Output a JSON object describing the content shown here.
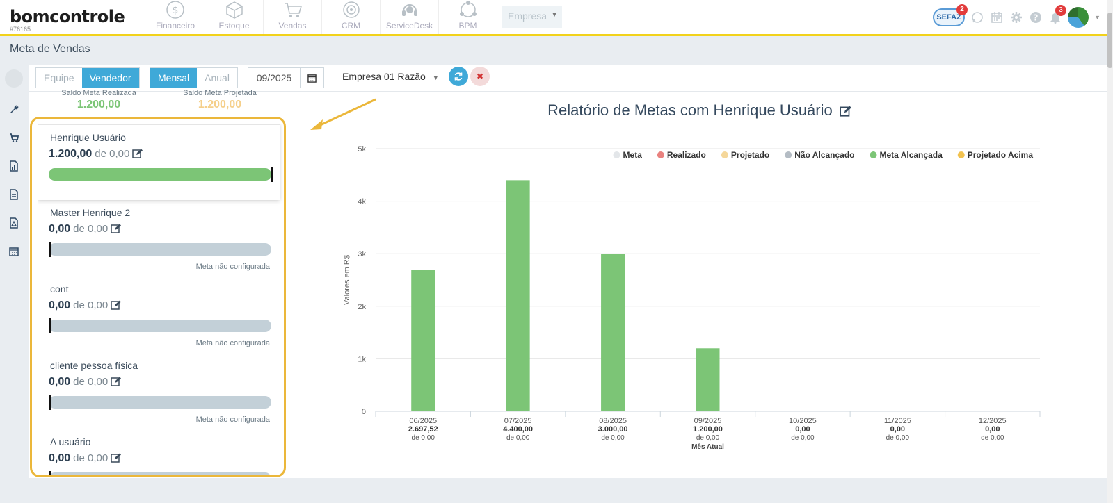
{
  "app": {
    "logo": "bomcontrole",
    "account_id": "#76165"
  },
  "modules": [
    "Financeiro",
    "Estoque",
    "Vendas",
    "CRM",
    "ServiceDesk",
    "BPM"
  ],
  "empresa_select": "Empresa",
  "header_right": {
    "sefaz_label": "SEFAZ",
    "sefaz_badge": "2",
    "notif_badge": "3"
  },
  "page": {
    "title": "Meta de Vendas"
  },
  "toolbar": {
    "scope_options": [
      "Equipe",
      "Vendedor"
    ],
    "scope_active": "Vendedor",
    "period_options": [
      "Mensal",
      "Anual"
    ],
    "period_active": "Mensal",
    "date_value": "09/2025",
    "empresa_dropdown": "Empresa 01 Razão"
  },
  "saldo": {
    "realizada_label": "Saldo Meta Realizada",
    "realizada_value": "1.200,00",
    "projetada_label": "Saldo Meta Projetada",
    "projetada_value": "1.200,00"
  },
  "users": [
    {
      "name": "Henrique Usuário",
      "realizado": "1.200,00",
      "de_label": "de 0,00",
      "progress": 1.0,
      "note": ""
    },
    {
      "name": "Master Henrique 2",
      "realizado": "0,00",
      "de_label": "de 0,00",
      "progress": 0.0,
      "note": "Meta não configurada"
    },
    {
      "name": "cont",
      "realizado": "0,00",
      "de_label": "de 0,00",
      "progress": 0.0,
      "note": "Meta não configurada"
    },
    {
      "name": "cliente pessoa física",
      "realizado": "0,00",
      "de_label": "de 0,00",
      "progress": 0.0,
      "note": "Meta não configurada"
    },
    {
      "name": "A usuário",
      "realizado": "0,00",
      "de_label": "de 0,00",
      "progress": 0.0,
      "note": ""
    }
  ],
  "colors": {
    "accent": "#3fa9d8",
    "highlight": "#ebb73a",
    "realizada_green": "#7cc576",
    "projetada_yellow": "#f5cf8a"
  },
  "chart_data": {
    "type": "bar",
    "title": "Relatório de Metas com Henrique Usuário",
    "ylabel": "Valores em R$",
    "ylim": [
      0,
      5000
    ],
    "yticks": [
      "0",
      "1k",
      "2k",
      "3k",
      "4k",
      "5k"
    ],
    "grid": true,
    "legend_position": "top-right",
    "legend": [
      {
        "name": "Meta",
        "color": "#e3e6e9"
      },
      {
        "name": "Realizado",
        "color": "#e9827f"
      },
      {
        "name": "Projetado",
        "color": "#f5d79a"
      },
      {
        "name": "Não Alcançado",
        "color": "#b4bcc4"
      },
      {
        "name": "Meta Alcançada",
        "color": "#7cc576"
      },
      {
        "name": "Projetado Acima",
        "color": "#f2c24f"
      }
    ],
    "categories": [
      "06/2025",
      "07/2025",
      "08/2025",
      "09/2025",
      "10/2025",
      "11/2025",
      "12/2025"
    ],
    "category_values_label": [
      "2.697,52",
      "4.400,00",
      "3.000,00",
      "1.200,00",
      "0,00",
      "0,00",
      "0,00"
    ],
    "category_meta_label": [
      "de 0,00",
      "de 0,00",
      "de 0,00",
      "de 0,00",
      "de 0,00",
      "de 0,00",
      "de 0,00"
    ],
    "current_month_label": "Mês Atual",
    "current_month_index": 3,
    "series": [
      {
        "name": "Meta Alcançada",
        "values": [
          2697.52,
          4400,
          3000,
          1200,
          0,
          0,
          0
        ]
      }
    ]
  }
}
